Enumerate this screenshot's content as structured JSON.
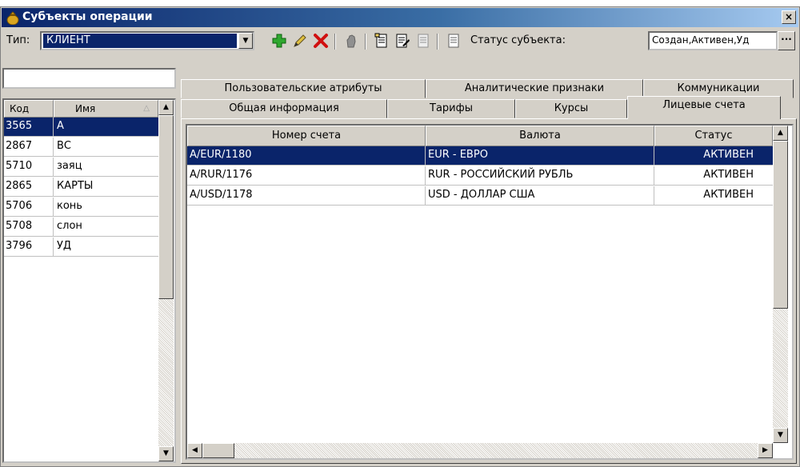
{
  "window": {
    "title": "Субъекты операции",
    "close_glyph": "×"
  },
  "toolbar": {
    "type_label": "Тип:",
    "type_value": "КЛИЕНТ",
    "status_label": "Статус субъекта:",
    "status_value": "Создан,Активен,Уд",
    "ellipsis_label": "···",
    "icons": [
      "add-icon",
      "edit-icon",
      "delete-icon",
      "hand-icon",
      "doc-icon",
      "doc-edit-icon",
      "doc-disabled-icon",
      "doc-list-icon"
    ]
  },
  "left": {
    "search_value": "",
    "columns": [
      "Код",
      "Имя"
    ],
    "rows": [
      {
        "code": "3565",
        "name": "А",
        "selected": true
      },
      {
        "code": "2867",
        "name": "ВС",
        "selected": false
      },
      {
        "code": "5710",
        "name": "заяц",
        "selected": false
      },
      {
        "code": "2865",
        "name": "КАРТЫ",
        "selected": false
      },
      {
        "code": "5706",
        "name": "конь",
        "selected": false
      },
      {
        "code": "5708",
        "name": "слон",
        "selected": false
      },
      {
        "code": "3796",
        "name": "УД",
        "selected": false
      }
    ]
  },
  "tabs": {
    "row1": [
      "Пользовательские атрибуты",
      "Аналитические признаки",
      "Коммуникации"
    ],
    "row2": [
      "Общая информация",
      "Тарифы",
      "Курсы",
      "Лицевые счета"
    ],
    "active": "Лицевые счета"
  },
  "grid": {
    "columns": [
      "Номер счета",
      "Валюта",
      "Статус"
    ],
    "rows": [
      {
        "account": "A/EUR/1180",
        "currency": "EUR - ЕВРО",
        "status": "АКТИВЕН",
        "selected": true
      },
      {
        "account": "A/RUR/1176",
        "currency": "RUR - РОССИЙСКИЙ РУБЛЬ",
        "status": "АКТИВЕН",
        "selected": false
      },
      {
        "account": "A/USD/1178",
        "currency": "USD - ДОЛЛАР США",
        "status": "АКТИВЕН",
        "selected": false
      }
    ]
  },
  "colors": {
    "title_start": "#0a246a",
    "title_end": "#a6caf0",
    "selection": "#0a246a",
    "face": "#d4d0c8"
  }
}
